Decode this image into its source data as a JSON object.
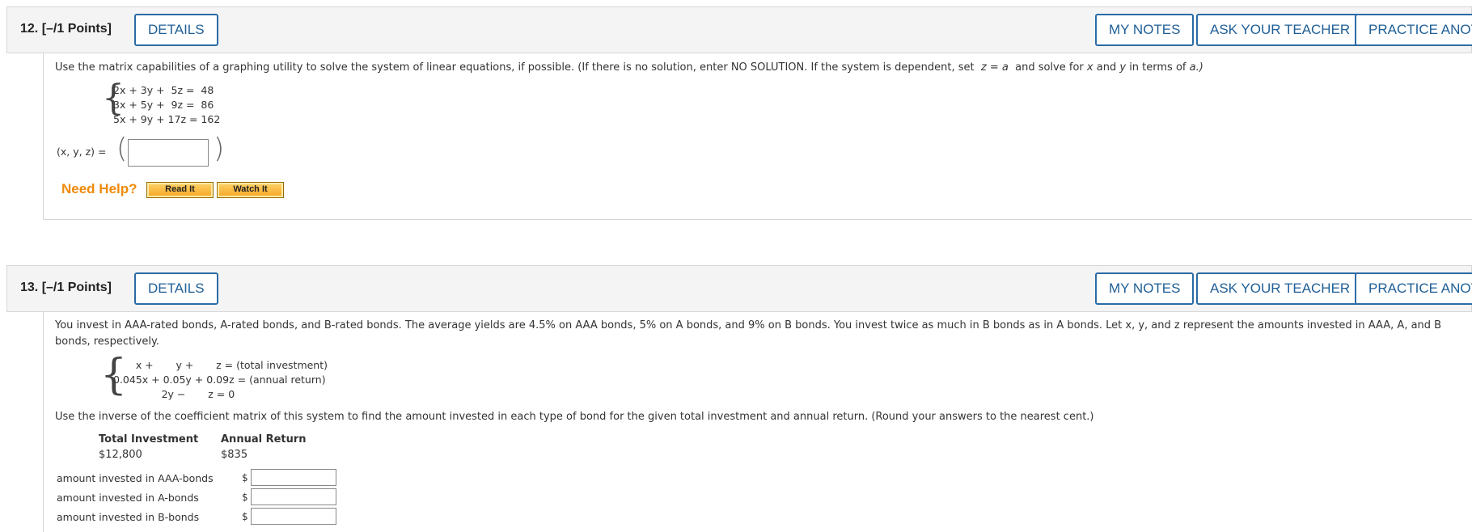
{
  "buttons": {
    "details": "DETAILS",
    "my_notes": "MY NOTES",
    "ask_teacher": "ASK YOUR TEACHER",
    "practice": "PRACTICE ANOTHER"
  },
  "q12": {
    "number": "12.",
    "points": "[–/1 Points]",
    "prompt_a": "Use the matrix capabilities of a graphing utility to solve the system of linear equations, if possible. (If there is no solution, enter NO SOLUTION. If the system is dependent, set",
    "prompt_b": "z = a",
    "prompt_c": "and solve for",
    "prompt_d": "x",
    "prompt_e": "and",
    "prompt_f": "y",
    "prompt_g": "in terms of",
    "prompt_h": "a.)",
    "equations": [
      "2x + 3y +  5z =  48",
      "3x + 5y +  9z =  86",
      "5x + 9y + 17z = 162"
    ],
    "answer_label": "(x, y, z) =",
    "need_help": "Need Help?",
    "read_it": "Read It",
    "watch_it": "Watch It"
  },
  "q13": {
    "number": "13.",
    "points": "[–/1 Points]",
    "prompt_line1": "You invest in AAA-rated bonds, A-rated bonds, and B-rated bonds. The average yields are 4.5% on AAA bonds, 5% on A bonds, and 9% on B bonds. You invest twice as much in B bonds as in A bonds. Let x, y, and z represent the amounts invested in AAA, A, and B",
    "prompt_line2": "bonds, respectively.",
    "equations": [
      "       x +       y +       z = (total investment)",
      "0.045x + 0.05y + 0.09z = (annual return)",
      "               2y −       z = 0"
    ],
    "instruction": "Use the inverse of the coefficient matrix of this system to find the amount invested in each type of bond for the given total investment and annual return. (Round your answers to the nearest cent.)",
    "table_headers": [
      "Total Investment",
      "Annual Return"
    ],
    "table_values": [
      "$12,800",
      "$835"
    ],
    "answers": [
      {
        "label": "amount invested in AAA-bonds",
        "currency": "$"
      },
      {
        "label": "amount invested in A-bonds",
        "currency": "$"
      },
      {
        "label": "amount invested in B-bonds",
        "currency": "$"
      }
    ]
  },
  "colors": {
    "accent": "#2a6ba5",
    "help": "#f08a0a",
    "header_bg": "#f4f4f4"
  }
}
